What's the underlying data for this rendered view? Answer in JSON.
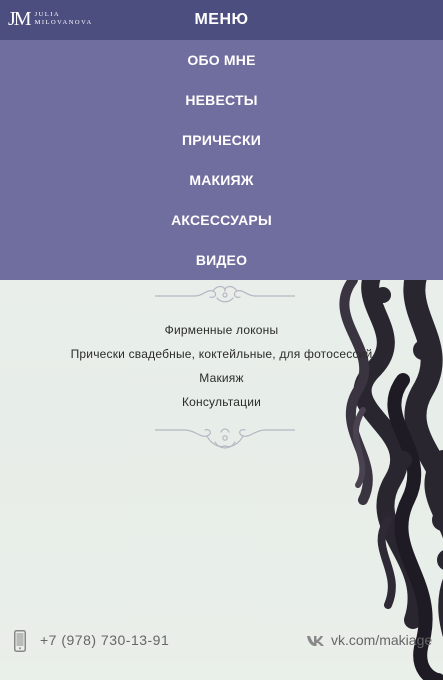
{
  "header": {
    "logo_mark": "JM",
    "logo_line1": "JULIA",
    "logo_line2": "MILOVANOVA",
    "menu_label": "МЕНЮ"
  },
  "menu": {
    "items": [
      {
        "label": "ОБО МНЕ"
      },
      {
        "label": "НЕВЕСТЫ"
      },
      {
        "label": "ПРИЧЕСКИ"
      },
      {
        "label": "МАКИЯЖ"
      },
      {
        "label": "АКСЕССУАРЫ"
      },
      {
        "label": "ВИДЕО"
      }
    ]
  },
  "services": {
    "items": [
      {
        "label": "Фирменные локоны"
      },
      {
        "label": "Прически свадебные, коктейльные, для фотосессий"
      },
      {
        "label": "Макияж"
      },
      {
        "label": "Консультации"
      }
    ]
  },
  "footer": {
    "phone": "+7 (978) 730-13-91",
    "vk_link": "vk.com/makiage"
  },
  "colors": {
    "header": "#4c4e80",
    "menu": "#706e9e",
    "background": "#e9efe9",
    "ornament": "#b7b7c4"
  }
}
